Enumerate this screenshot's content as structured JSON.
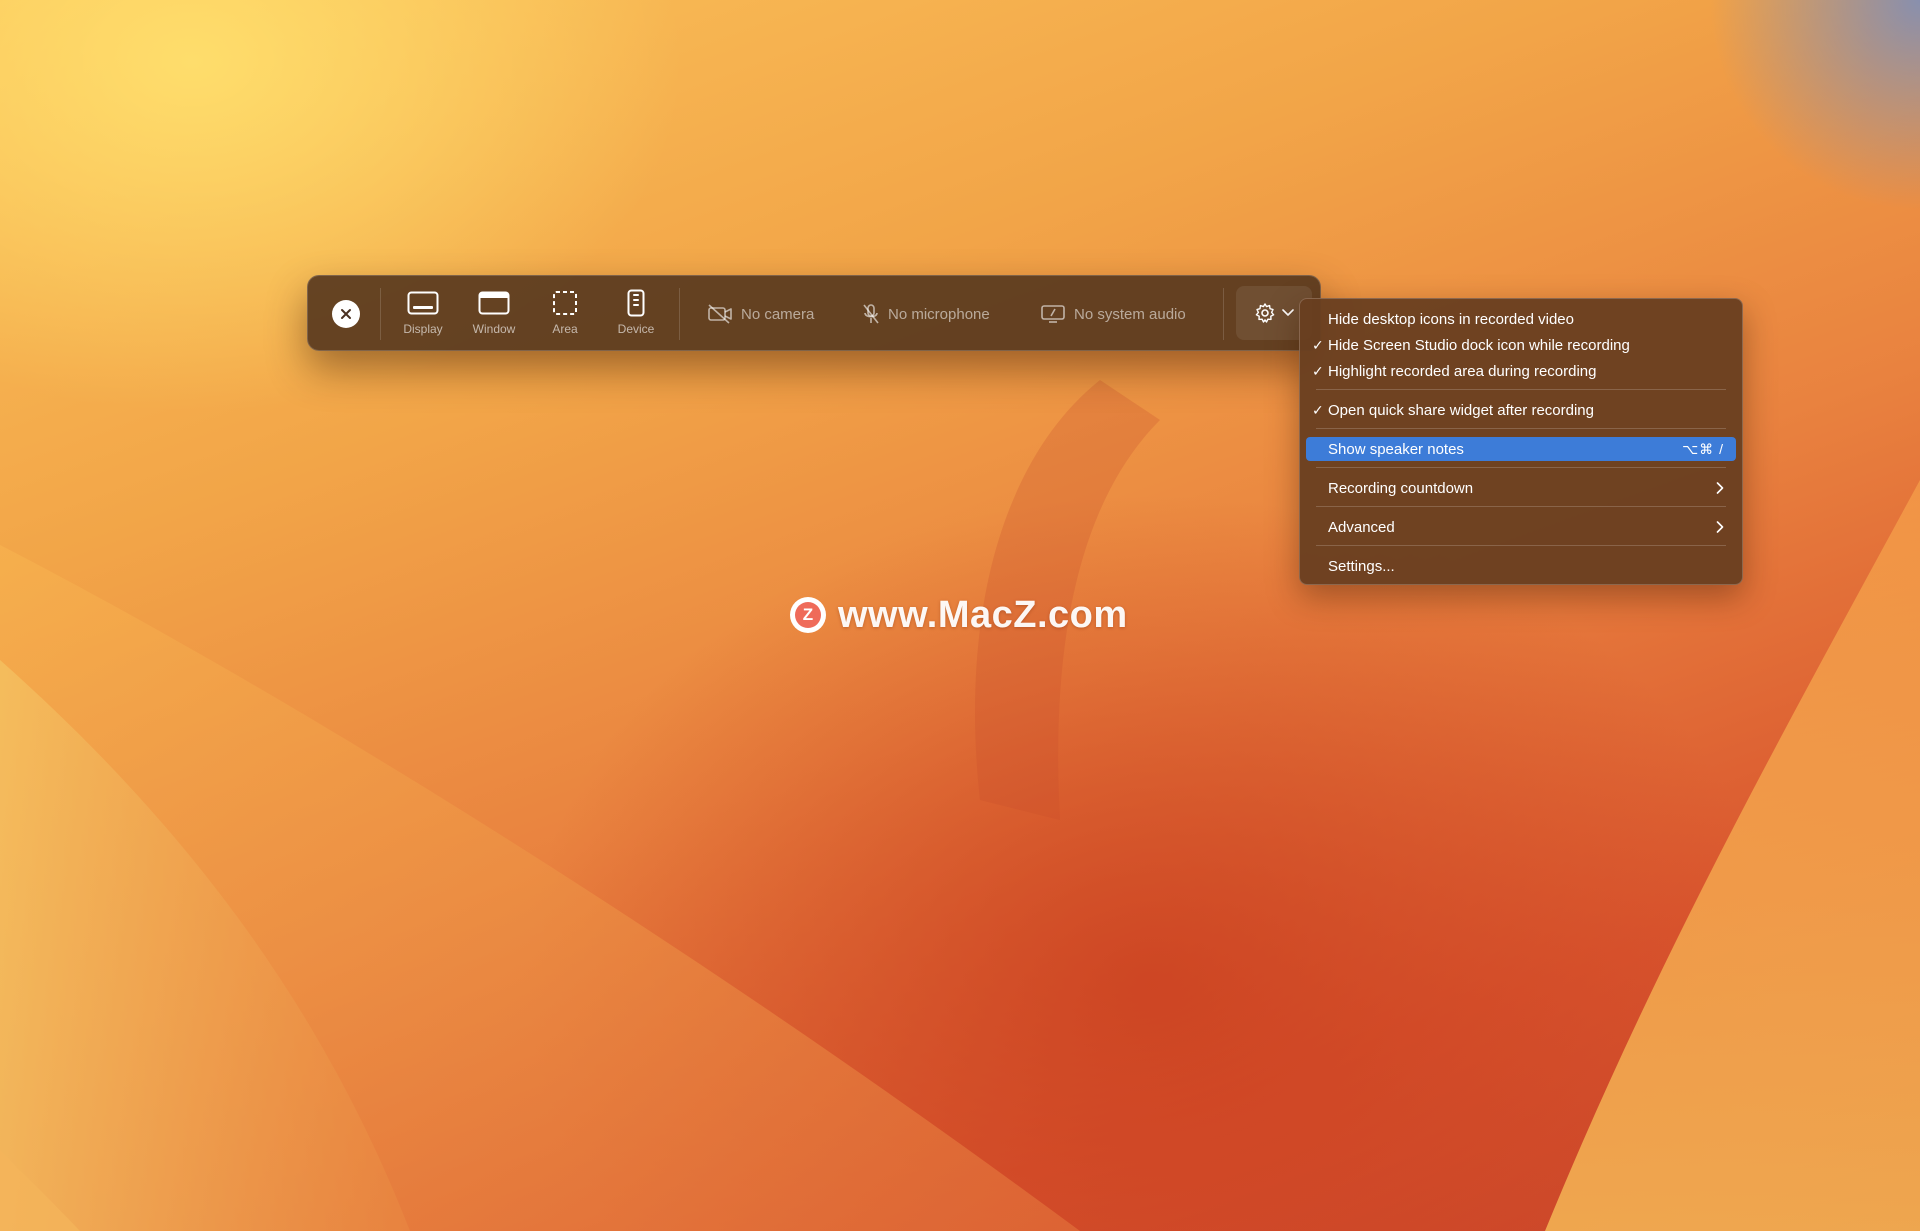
{
  "toolbar": {
    "modes": [
      {
        "label": "Display",
        "icon": "display-icon"
      },
      {
        "label": "Window",
        "icon": "window-icon"
      },
      {
        "label": "Area",
        "icon": "area-icon"
      },
      {
        "label": "Device",
        "icon": "device-icon"
      }
    ],
    "camera_label": "No camera",
    "microphone_label": "No microphone",
    "system_audio_label": "No system audio"
  },
  "menu": {
    "items": [
      {
        "label": "Hide desktop icons in recorded video",
        "checked": false
      },
      {
        "label": "Hide Screen Studio dock icon while recording",
        "checked": true
      },
      {
        "label": "Highlight recorded area during recording",
        "checked": true
      },
      {
        "label": "Open quick share widget after recording",
        "checked": true
      },
      {
        "label": "Show speaker notes",
        "shortcut": "⌥⌘ /",
        "highlighted": true
      },
      {
        "label": "Recording countdown",
        "submenu": true
      },
      {
        "label": "Advanced",
        "submenu": true
      },
      {
        "label": "Settings..."
      }
    ],
    "check_glyph": "✓",
    "highlight_color": "#3d7cd8"
  },
  "watermark": {
    "logo_letter": "Z",
    "text": "www.MacZ.com"
  }
}
